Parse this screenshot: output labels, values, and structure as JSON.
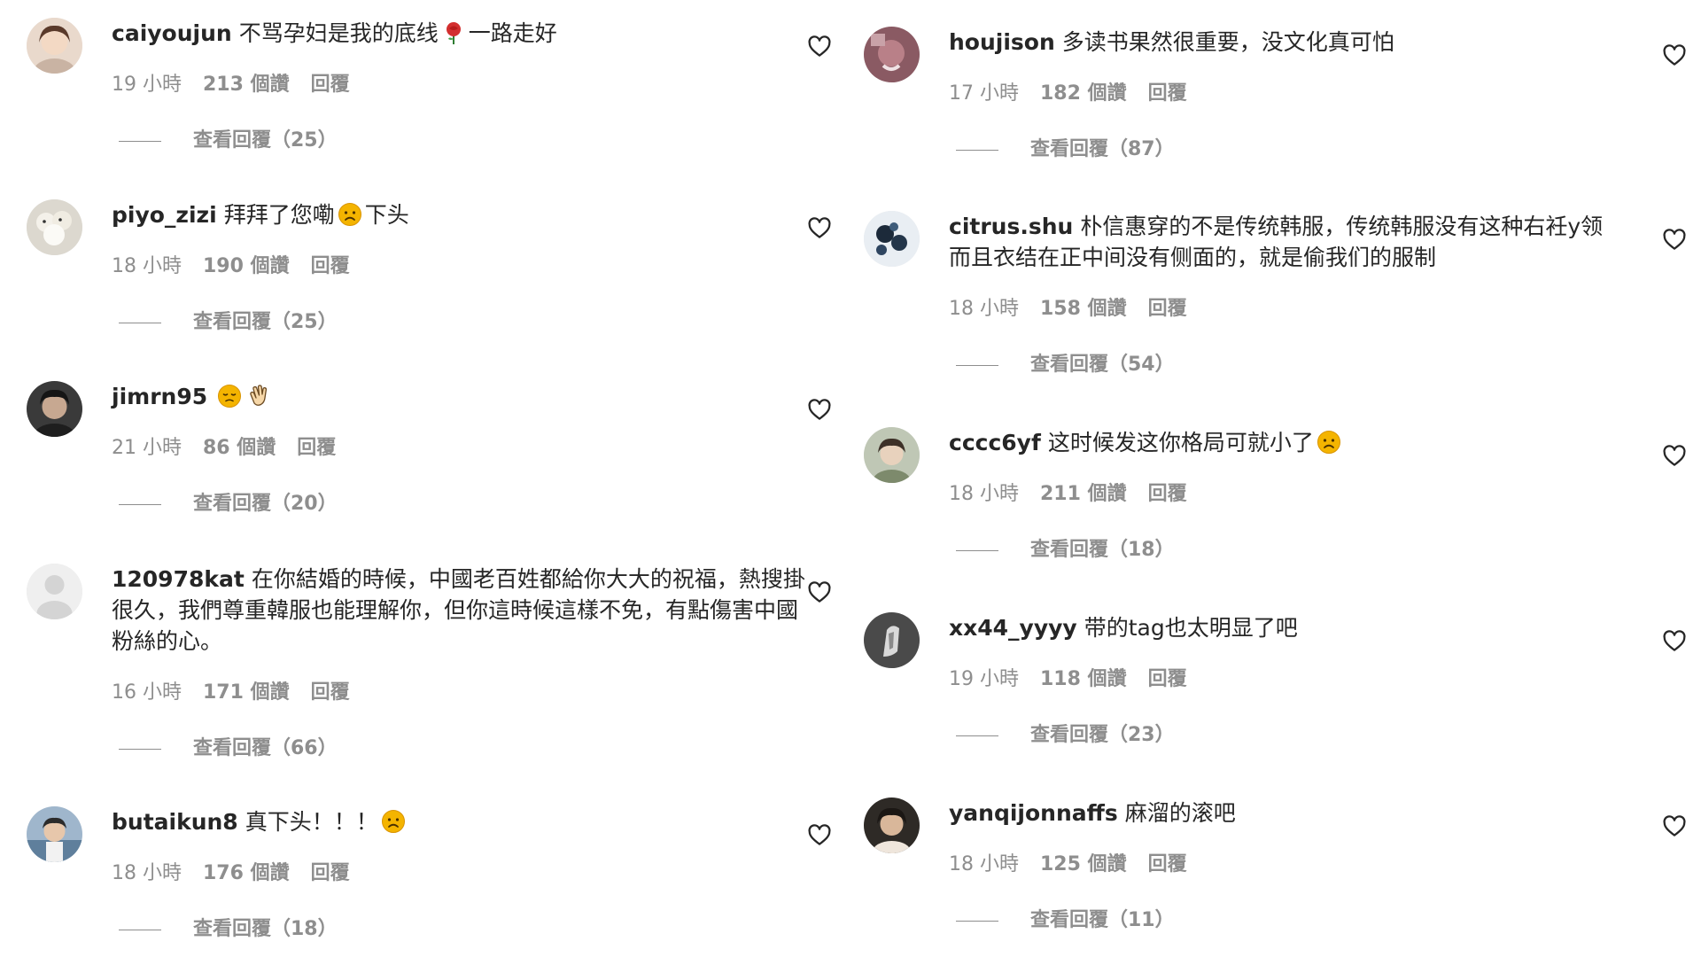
{
  "left_comments": [
    {
      "username": "caiyoujun",
      "text_before": "不骂孕妇是我的底线",
      "emoji": "rose",
      "text_after": "一路走好",
      "time": "19 小時",
      "likes": "213 個讚",
      "reply": "回覆",
      "view_replies": "查看回覆（25）"
    },
    {
      "username": "piyo_zizi",
      "text_before": "拜拜了您嘞",
      "emoji": "sad-face",
      "text_after": "下头",
      "time": "18 小時",
      "likes": "190 個讚",
      "reply": "回覆",
      "view_replies": "查看回覆（25）"
    },
    {
      "username": "jimrn95",
      "text_before": "",
      "emoji": "disappointed-face",
      "emoji2": "waving-hand",
      "text_after": "",
      "time": "21 小時",
      "likes": "86 個讚",
      "reply": "回覆",
      "view_replies": "查看回覆（20）"
    },
    {
      "username": "120978kat",
      "text_before": "在你結婚的時候，中國老百姓都給你大大的祝福，熱搜掛很久，我們尊重韓服也能理解你，但你這時候這樣不免，有點傷害中國粉絲的心。",
      "text_after": "",
      "time": "16 小時",
      "likes": "171 個讚",
      "reply": "回覆",
      "view_replies": "查看回覆（66）"
    },
    {
      "username": "butaikun8",
      "text_before": "真下头！！！",
      "emoji": "sad-face",
      "text_after": "",
      "time": "18 小時",
      "likes": "176 個讚",
      "reply": "回覆",
      "view_replies": "查看回覆（18）"
    }
  ],
  "right_comments": [
    {
      "username": "houjison",
      "text_before": "多读书果然很重要，没文化真可怕",
      "text_after": "",
      "time": "17 小時",
      "likes": "182 個讚",
      "reply": "回覆",
      "view_replies": "查看回覆（87）"
    },
    {
      "username": "citrus.shu",
      "text_before": "朴信惠穿的不是传统韩服，传统韩服没有这种右衽y领而且衣结在正中间没有侧面的，就是偷我们的服制",
      "text_after": "",
      "time": "18 小時",
      "likes": "158 個讚",
      "reply": "回覆",
      "view_replies": "查看回覆（54）"
    },
    {
      "username": "cccc6yf",
      "text_before": "这时候发这你格局可就小了",
      "emoji": "sad-face",
      "text_after": "",
      "time": "18 小時",
      "likes": "211 個讚",
      "reply": "回覆",
      "view_replies": "查看回覆（18）"
    },
    {
      "username": "xx44_yyyy",
      "text_before": "带的tag也太明显了吧",
      "text_after": "",
      "time": "19 小時",
      "likes": "118 個讚",
      "reply": "回覆",
      "view_replies": "查看回覆（23）"
    },
    {
      "username": "yanqijonnaffs",
      "text_before": "麻溜的滚吧",
      "text_after": "",
      "time": "18 小時",
      "likes": "125 個讚",
      "reply": "回覆",
      "view_replies": "查看回覆（11）"
    }
  ],
  "icons": {
    "like": "heart-outline-icon",
    "emoji_color": "#f4b400"
  },
  "colors": {
    "text": "#262626",
    "secondary": "#8e8e8e"
  }
}
